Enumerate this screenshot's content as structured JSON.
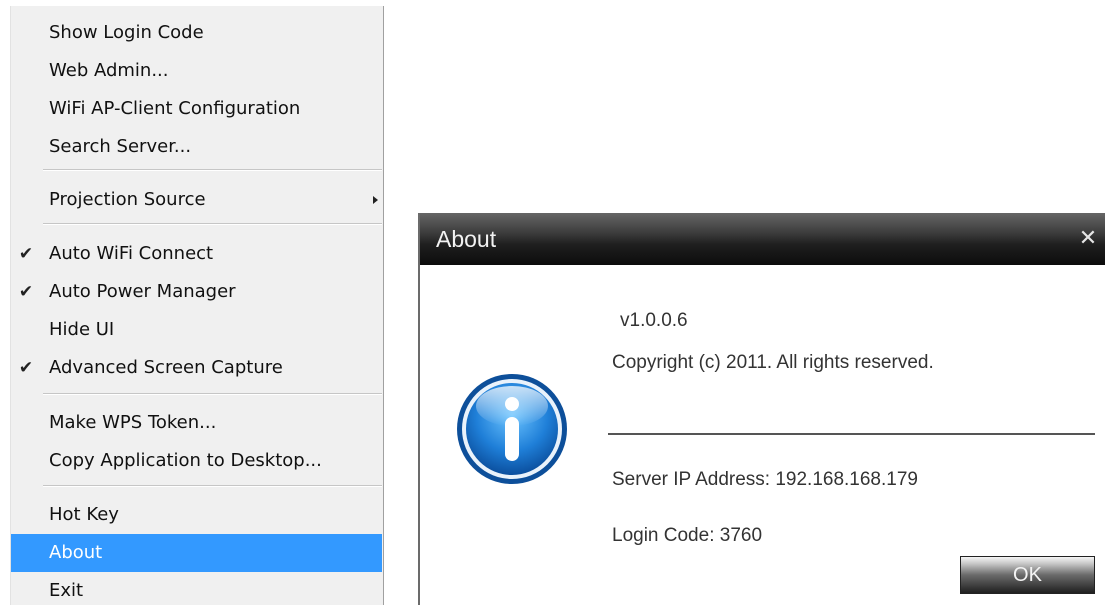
{
  "menu": {
    "items": [
      {
        "label": "Show Login Code"
      },
      {
        "label": "Web Admin..."
      },
      {
        "label": "WiFi AP-Client Configuration"
      },
      {
        "label": "Search Server..."
      },
      {
        "label": "Projection Source"
      },
      {
        "label": "Auto WiFi Connect",
        "checked": true
      },
      {
        "label": "Auto Power Manager",
        "checked": true
      },
      {
        "label": "Hide UI"
      },
      {
        "label": "Advanced Screen Capture",
        "checked": true
      },
      {
        "label": "Make WPS Token..."
      },
      {
        "label": "Copy Application to Desktop..."
      },
      {
        "label": "Hot Key"
      },
      {
        "label": "About",
        "selected": true
      },
      {
        "label": "Exit"
      }
    ],
    "check_glyph": "✔",
    "highlight_color": "#3399ff"
  },
  "dialog": {
    "title": "About",
    "close_glyph": "✕",
    "version": "v1.0.0.6",
    "copyright": "Copyright (c) 2011. All rights reserved.",
    "server_ip": "Server IP Address: 192.168.168.179",
    "login_code": "Login Code: 3760",
    "ok_label": "OK",
    "icon": "info-icon"
  }
}
